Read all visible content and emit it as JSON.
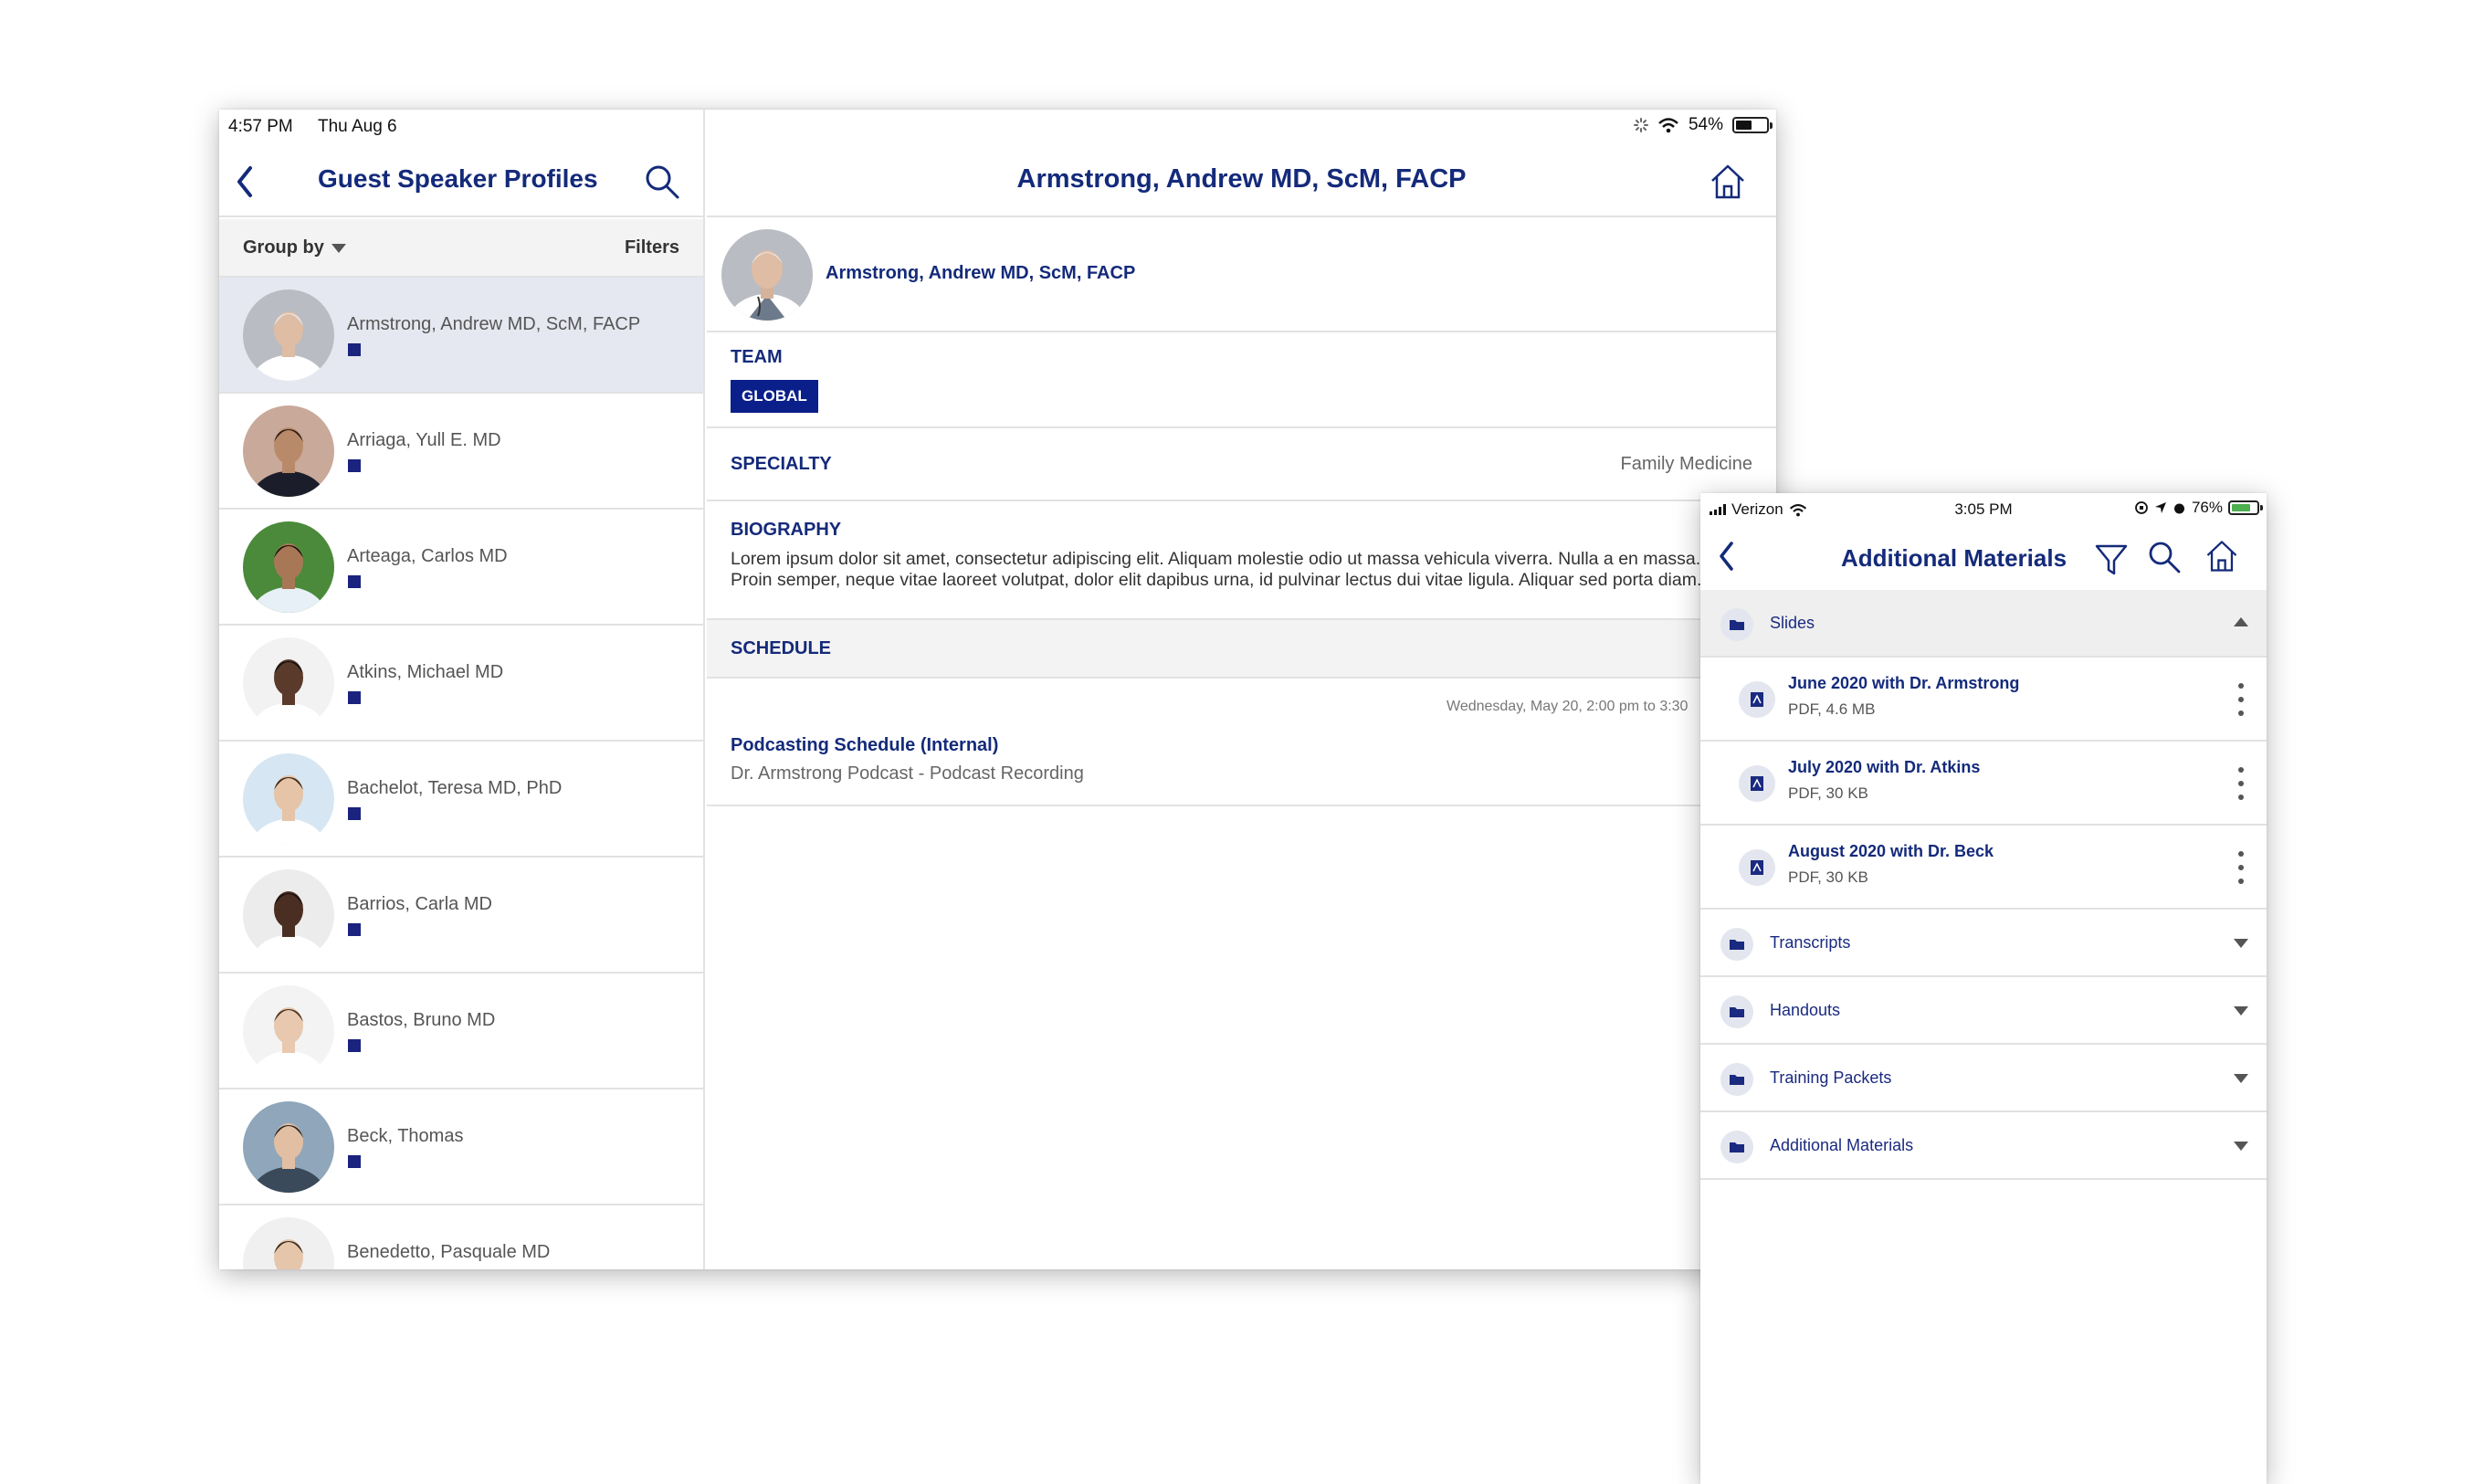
{
  "tablet": {
    "status": {
      "time": "4:57 PM",
      "date": "Thu Aug 6",
      "battery": "54%",
      "battery_level": 0.54
    },
    "left": {
      "title": "Guest Speaker Profiles",
      "group_by": "Group by",
      "filters": "Filters",
      "speakers": [
        {
          "name": "Armstrong, Andrew MD, ScM, FACP",
          "selected": true
        },
        {
          "name": "Arriaga, Yull E. MD"
        },
        {
          "name": "Arteaga, Carlos MD"
        },
        {
          "name": "Atkins, Michael MD"
        },
        {
          "name": "Bachelot, Teresa MD, PhD"
        },
        {
          "name": "Barrios, Carla MD"
        },
        {
          "name": "Bastos, Bruno MD"
        },
        {
          "name": "Beck, Thomas"
        },
        {
          "name": "Benedetto, Pasquale MD"
        }
      ]
    },
    "detail": {
      "title": "Armstrong, Andrew MD, ScM, FACP",
      "profile_name": "Armstrong, Andrew MD, ScM, FACP",
      "team_label": "TEAM",
      "team_tag": "GLOBAL",
      "specialty_label": "SPECIALTY",
      "specialty_value": "Family Medicine",
      "biography_label": "BIOGRAPHY",
      "biography_text": "Lorem ipsum dolor sit amet, consectetur adipiscing elit. Aliquam molestie odio ut massa vehicula viverra. Nulla a en massa. Proin semper, neque vitae laoreet volutpat, dolor elit dapibus urna, id pulvinar lectus dui vitae ligula. Aliquar sed porta diam.",
      "schedule_label": "SCHEDULE",
      "schedule_item": {
        "when": "Wednesday, May 20, 2:00 pm to 3:30",
        "title": "Podcasting Schedule (Internal)",
        "subtitle": "Dr. Armstrong Podcast - Podcast Recording"
      }
    }
  },
  "phone": {
    "status": {
      "carrier": "Verizon",
      "time": "3:05 PM",
      "battery": "76%",
      "battery_level": 0.76
    },
    "title": "Additional Materials",
    "folders": {
      "slides": "Slides",
      "files": [
        {
          "title": "June 2020 with Dr. Armstrong",
          "meta": "PDF, 4.6 MB"
        },
        {
          "title": "July 2020 with Dr. Atkins",
          "meta": "PDF, 30 KB"
        },
        {
          "title": "August 2020 with Dr. Beck",
          "meta": "PDF, 30 KB"
        }
      ],
      "transcripts": "Transcripts",
      "handouts": "Handouts",
      "training": "Training Packets",
      "additional": "Additional Materials"
    }
  },
  "colors": {
    "brand_navy": "#142a7a",
    "tag_blue": "#0a1f8a",
    "badge": "#1a237e"
  }
}
